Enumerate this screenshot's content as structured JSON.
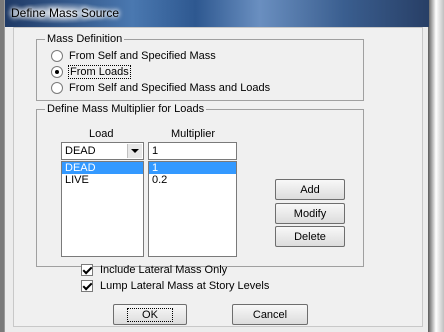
{
  "window": {
    "title": "Define Mass Source"
  },
  "mass_definition": {
    "legend": "Mass Definition",
    "options": [
      {
        "label": "From Self and Specified Mass",
        "checked": false
      },
      {
        "label": "From Loads",
        "checked": true
      },
      {
        "label": "From Self and Specified Mass and Loads",
        "checked": false
      }
    ]
  },
  "multiplier_section": {
    "legend": "Define Mass Multiplier for Loads",
    "load_header": "Load",
    "multiplier_header": "Multiplier",
    "load_combo_value": "DEAD",
    "multiplier_input_value": "1",
    "rows": [
      {
        "load": "DEAD",
        "multiplier": "1",
        "selected": true
      },
      {
        "load": "LIVE",
        "multiplier": "0.2",
        "selected": false
      }
    ],
    "add_label": "Add",
    "modify_label": "Modify",
    "delete_label": "Delete"
  },
  "options": {
    "include_lateral": {
      "label": "Include Lateral Mass Only",
      "checked": true
    },
    "lump_lateral": {
      "label": "Lump Lateral Mass at Story Levels",
      "checked": true
    }
  },
  "footer": {
    "ok_label": "OK",
    "cancel_label": "Cancel"
  }
}
